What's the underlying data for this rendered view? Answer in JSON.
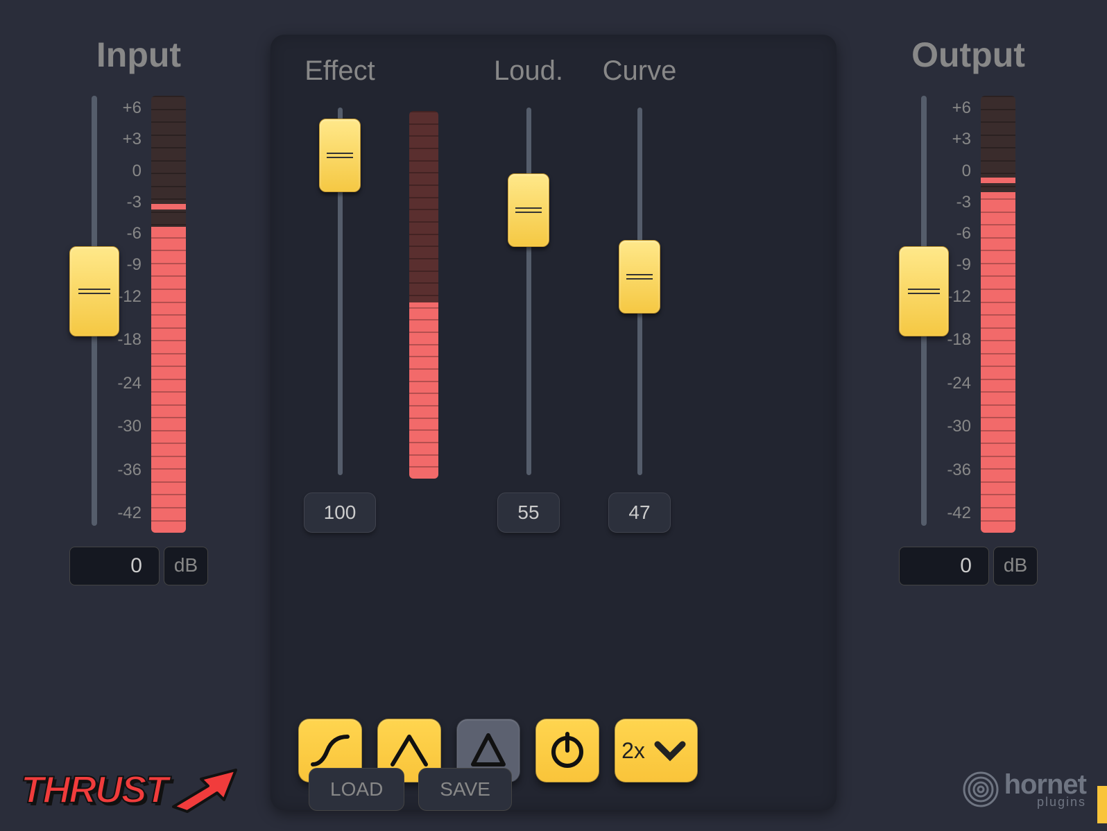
{
  "input": {
    "title": "Input",
    "value": "0",
    "unit": "dB",
    "slider_percent": 35,
    "meter_fill_percent": 70,
    "meter_peak_percent": 74,
    "scale": [
      "+6",
      "+3",
      "0",
      "-3",
      "-6",
      "-9",
      "-12",
      "",
      "-18",
      "",
      "-24",
      "",
      "-30",
      "",
      "-36",
      "",
      "-42"
    ]
  },
  "output": {
    "title": "Output",
    "value": "0",
    "unit": "dB",
    "slider_percent": 35,
    "meter_fill_percent": 78,
    "meter_peak_percent": 80
  },
  "center": {
    "effect": {
      "label": "Effect",
      "value": "100",
      "slider_percent": 3
    },
    "loud": {
      "label": "Loud.",
      "value": "55",
      "slider_percent": 18
    },
    "curve": {
      "label": "Curve",
      "value": "47",
      "slider_percent": 36
    },
    "gr_meter": {
      "bright_percent": 48
    }
  },
  "buttons": {
    "hpf_active": true,
    "band_active": true,
    "delta_active": false,
    "power_active": true,
    "oversample": "2x"
  },
  "footer": {
    "product": "THRUST",
    "load": "LOAD",
    "save": "SAVE",
    "brand": "hornet",
    "brand_sub": "plugins"
  }
}
